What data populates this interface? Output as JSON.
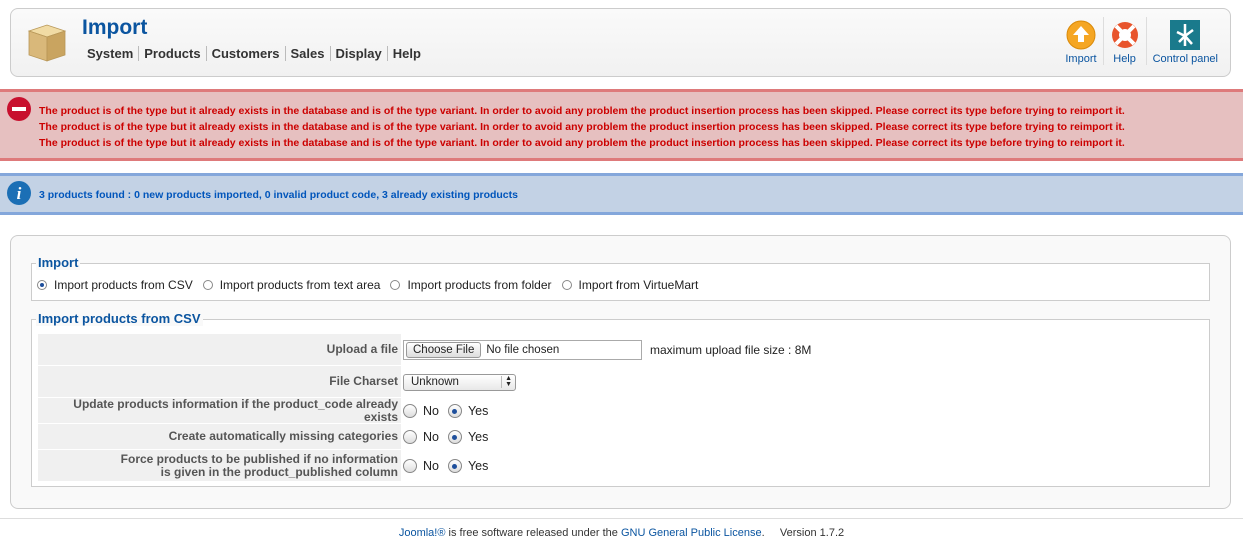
{
  "header": {
    "title": "Import",
    "menu": [
      "System",
      "Products",
      "Customers",
      "Sales",
      "Display",
      "Help"
    ]
  },
  "toolbar": {
    "import_label": "Import",
    "help_label": "Help",
    "control_panel_label": "Control panel"
  },
  "errors": [
    "The product is of the type but it already exists in the database and is of the type variant. In order to avoid any problem the product insertion process has been skipped. Please correct its type before trying to reimport it.",
    "The product is of the type but it already exists in the database and is of the type variant. In order to avoid any problem the product insertion process has been skipped. Please correct its type before trying to reimport it.",
    "The product is of the type but it already exists in the database and is of the type variant. In order to avoid any problem the product insertion process has been skipped. Please correct its type before trying to reimport it."
  ],
  "info": "3 products found : 0 new products imported, 0 invalid product code, 3 already existing products",
  "import_section": {
    "legend": "Import",
    "options": [
      {
        "label": "Import products from CSV",
        "selected": true
      },
      {
        "label": "Import products from text area",
        "selected": false
      },
      {
        "label": "Import products from folder",
        "selected": false
      },
      {
        "label": "Import from VirtueMart",
        "selected": false
      }
    ]
  },
  "csv_section": {
    "legend": "Import products from CSV",
    "upload_label": "Upload a file",
    "choose_file_button": "Choose File",
    "no_file_text": "No file chosen",
    "max_upload_text": "maximum upload file size : 8M",
    "charset_label": "File Charset",
    "charset_value": "Unknown",
    "update_label": "Update products information if the product_code already exists",
    "create_categories_label": "Create automatically missing categories",
    "force_published_label_line1": "Force products to be published if no information",
    "force_published_label_line2": "is given in the product_published column",
    "no_label": "No",
    "yes_label": "Yes"
  },
  "footer": {
    "joomla": "Joomla!®",
    "text1": " is free software released under the ",
    "license": "GNU General Public License",
    "text2": ".     Version 1.7.2"
  }
}
